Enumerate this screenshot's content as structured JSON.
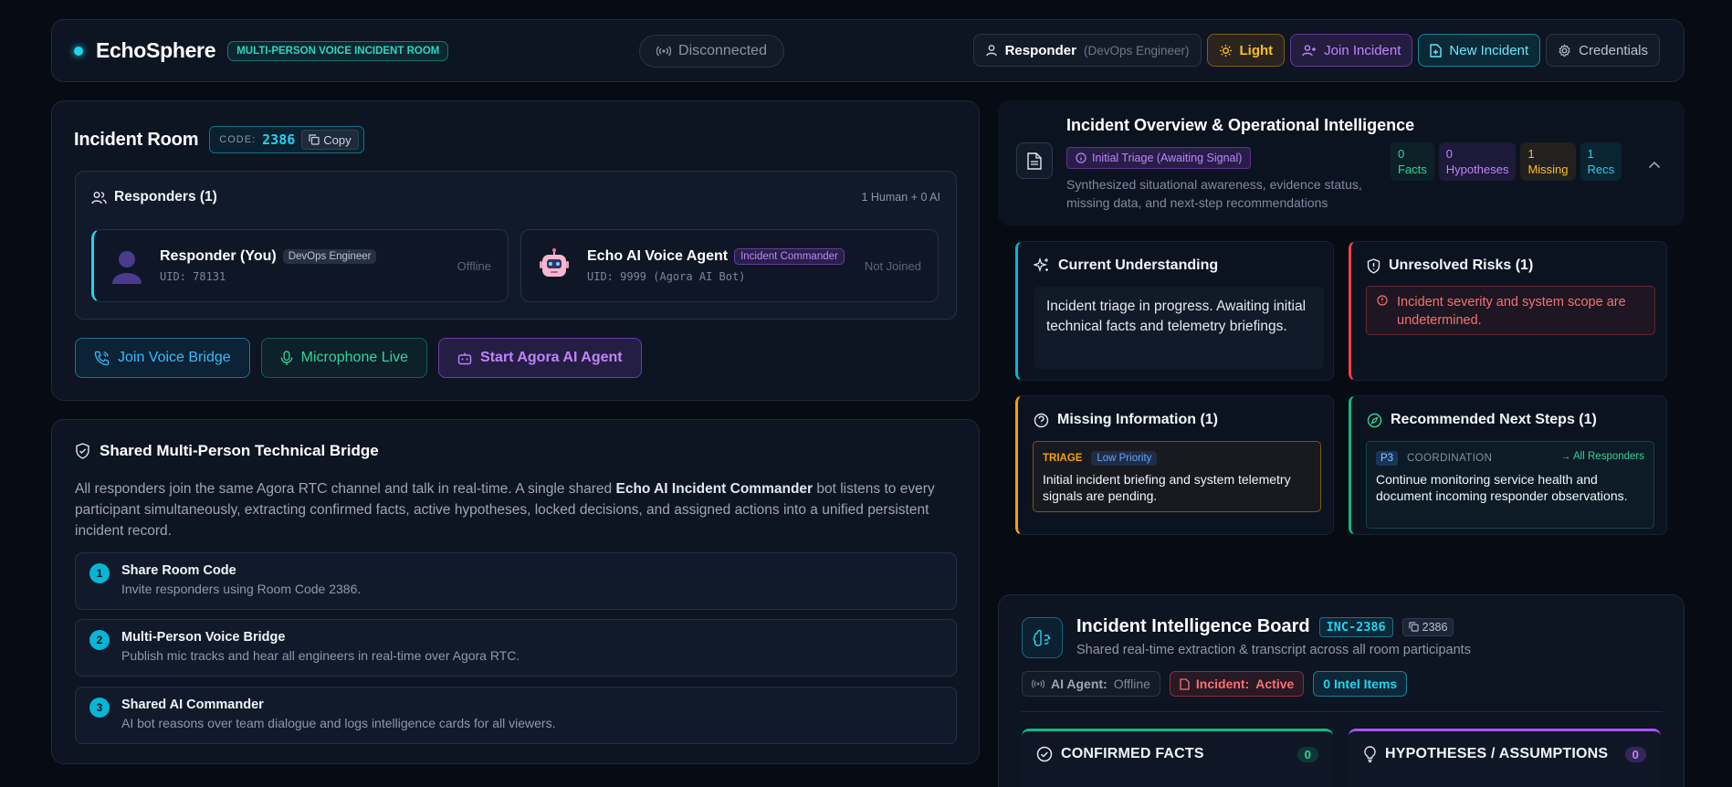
{
  "header": {
    "brand": "EchoSphere",
    "badge": "MULTI-PERSON VOICE INCIDENT ROOM",
    "connection": "Disconnected",
    "user_name": "Responder",
    "user_role": "(DevOps Engineer)",
    "theme_label": "Light",
    "join_label": "Join Incident",
    "new_label": "New Incident",
    "credentials_label": "Credentials"
  },
  "room": {
    "title": "Incident Room",
    "code_label": "CODE:",
    "code": "2386",
    "copy_label": "Copy",
    "responders_title": "Responders (1)",
    "responders_summary": "1 Human + 0 AI",
    "responders": [
      {
        "name": "Responder (You)",
        "role": "DevOps Engineer",
        "uid": "UID: 78131",
        "status": "Offline"
      },
      {
        "name": "Echo AI Voice Agent",
        "role": "Incident Commander",
        "uid": "UID: 9999 (Agora AI Bot)",
        "status": "Not Joined"
      }
    ],
    "actions": {
      "join_voice": "Join Voice Bridge",
      "microphone": "Microphone Live",
      "start_agent": "Start Agora AI Agent"
    }
  },
  "bridge": {
    "title": "Shared Multi-Person Technical Bridge",
    "desc_before": "All responders join the same Agora RTC channel and talk in real-time. A single shared ",
    "desc_bold": "Echo AI Incident Commander",
    "desc_after": " bot listens to every participant simultaneously, extracting confirmed facts, active hypotheses, locked decisions, and assigned actions into a unified persistent incident record.",
    "steps": [
      {
        "num": "1",
        "title": "Share Room Code",
        "desc": "Invite responders using Room Code 2386."
      },
      {
        "num": "2",
        "title": "Multi-Person Voice Bridge",
        "desc": "Publish mic tracks and hear all engineers in real-time over Agora RTC."
      },
      {
        "num": "3",
        "title": "Shared AI Commander",
        "desc": "AI bot reasons over team dialogue and logs intelligence cards for all viewers."
      }
    ]
  },
  "overview": {
    "title": "Incident Overview & Operational Intelligence",
    "status": "Initial Triage (Awaiting Signal)",
    "desc": "Synthesized situational awareness, evidence status, missing data, and next-step recommendations",
    "stats": [
      {
        "value": "0",
        "label": "Facts"
      },
      {
        "value": "0",
        "label": "Hypotheses"
      },
      {
        "value": "1",
        "label": "Missing"
      },
      {
        "value": "1",
        "label": "Recs"
      }
    ],
    "understanding_title": "Current Understanding",
    "understanding_text": "Incident triage in progress. Awaiting initial technical facts and telemetry briefings.",
    "risks_title": "Unresolved Risks (1)",
    "risk_text": "Incident severity and system scope are undetermined.",
    "missing_title": "Missing Information (1)",
    "missing_category": "TRIAGE",
    "missing_priority": "Low Priority",
    "missing_text": "Initial incident briefing and system telemetry signals are pending.",
    "next_title": "Recommended Next Steps (1)",
    "next_priority": "P3",
    "next_category": "COORDINATION",
    "next_target": "→ All Responders",
    "next_text": "Continue monitoring service health and document incoming responder observations."
  },
  "board": {
    "title": "Incident Intelligence Board",
    "incident_id": "INC-2386",
    "room_code": "2386",
    "subtitle": "Shared real-time extraction & transcript across all room participants",
    "agent_label": "AI Agent:",
    "agent_status": "Offline",
    "incident_label": "Incident:",
    "incident_status": "Active",
    "intel_items": "0 Intel Items",
    "facts_title": "CONFIRMED FACTS",
    "facts_count": "0",
    "hyp_title": "HYPOTHESES / ASSUMPTIONS",
    "hyp_count": "0"
  },
  "colors": {
    "accent": "#22d3ee",
    "purple": "#a855f7",
    "danger": "#ef4444",
    "warning": "#f59e0b",
    "success": "#10b981"
  }
}
